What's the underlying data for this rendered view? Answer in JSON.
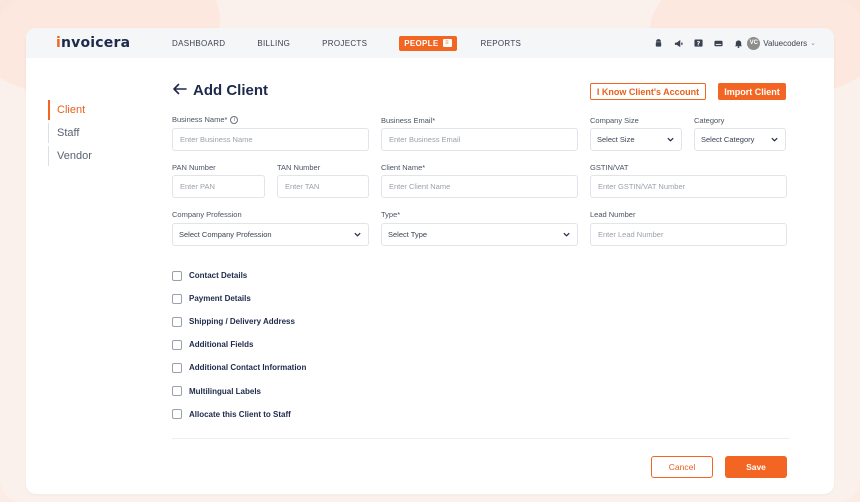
{
  "colors": {
    "accent": "#f26522",
    "navy": "#1e2a4a",
    "background": "#fbece4"
  },
  "brand": {
    "logo_text": "invoicera"
  },
  "nav": {
    "links": [
      "DASHBOARD",
      "BILLING",
      "PROJECTS",
      "PEOPLE",
      "REPORTS"
    ],
    "active": "PEOPLE",
    "icons": [
      "android-icon",
      "megaphone-icon",
      "help-icon",
      "keyboard-icon",
      "bell-icon"
    ],
    "user": {
      "initials": "VC",
      "name": "Valuecoders"
    }
  },
  "sidebar": {
    "items": [
      {
        "label": "Client",
        "active": true
      },
      {
        "label": "Staff"
      },
      {
        "label": "Vendor"
      }
    ]
  },
  "page": {
    "title": "Add Client",
    "know_account_label": "I Know Client's Account",
    "import_label": "Import Client"
  },
  "form": {
    "business_name": {
      "label": "Business Name*",
      "placeholder": "Enter Business Name"
    },
    "business_email": {
      "label": "Business Email*",
      "placeholder": "Enter Business Email"
    },
    "company_size": {
      "label": "Company Size",
      "value": "Select Size"
    },
    "category": {
      "label": "Category",
      "value": "Select Category"
    },
    "pan": {
      "label": "PAN Number",
      "placeholder": "Enter PAN"
    },
    "tan": {
      "label": "TAN Number",
      "placeholder": "Enter TAN"
    },
    "client_name": {
      "label": "Client Name*",
      "placeholder": "Enter Client Name"
    },
    "gstin": {
      "label": "GSTIN/VAT",
      "placeholder": "Enter GSTIN/VAT Number"
    },
    "profession": {
      "label": "Company Profession",
      "value": "Select Company Profession"
    },
    "type": {
      "label": "Type*",
      "value": "Select Type"
    },
    "lead": {
      "label": "Lead Number",
      "placeholder": "Enter Lead Number"
    }
  },
  "sections": [
    "Contact Details",
    "Payment Details",
    "Shipping / Delivery Address",
    "Additional Fields",
    "Additional Contact Information",
    "Multilingual Labels",
    "Allocate this Client to Staff"
  ],
  "actions": {
    "cancel": "Cancel",
    "save": "Save"
  }
}
